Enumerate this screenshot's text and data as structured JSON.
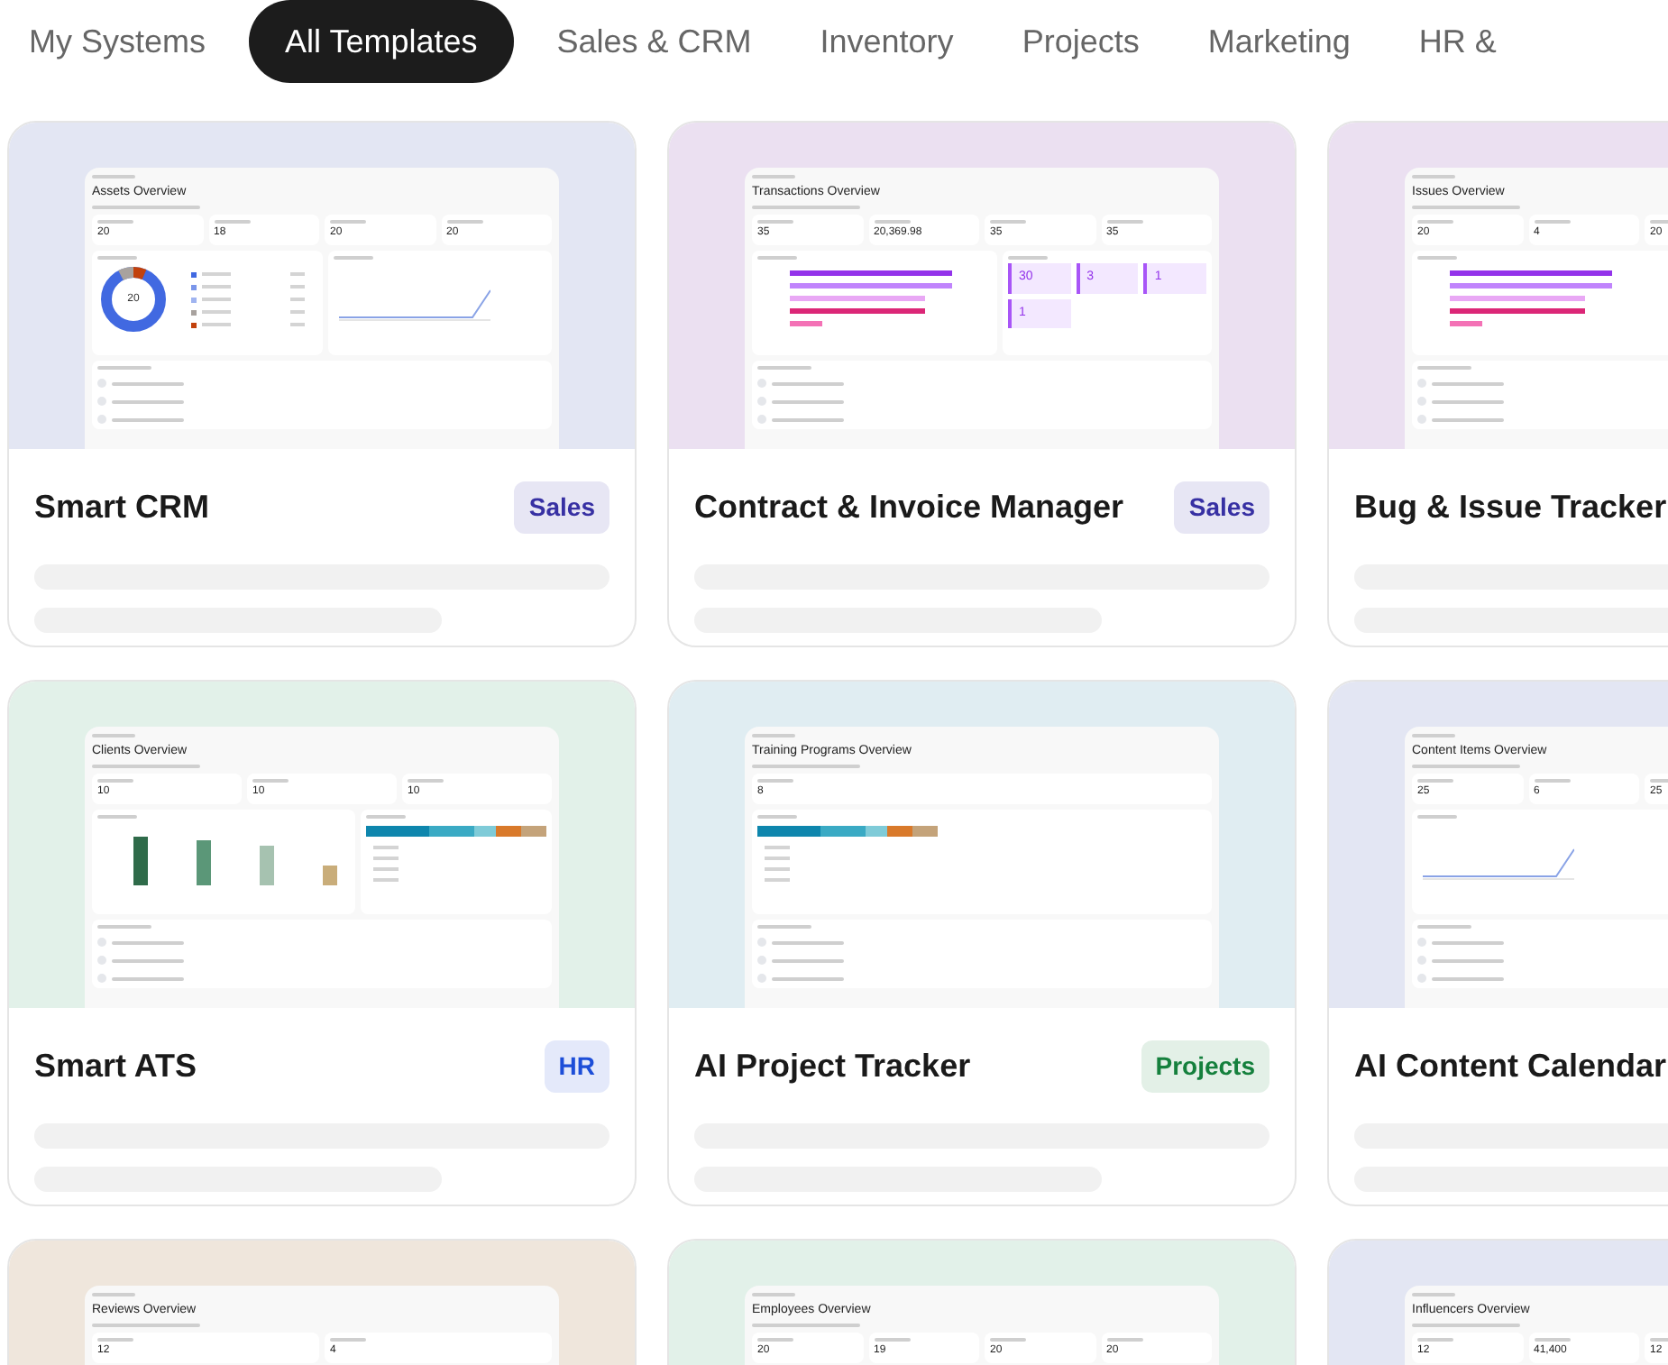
{
  "tabs": [
    {
      "label": "My Systems",
      "selected": false
    },
    {
      "label": "All Templates",
      "selected": true
    },
    {
      "label": "Sales & CRM",
      "selected": false
    },
    {
      "label": "Inventory",
      "selected": false
    },
    {
      "label": "Projects",
      "selected": false
    },
    {
      "label": "Marketing",
      "selected": false
    },
    {
      "label": "HR &",
      "selected": false
    }
  ],
  "templates": [
    {
      "title": "Smart CRM",
      "tag": {
        "label": "Sales",
        "color": "#3730a3"
      },
      "color": "#e3e6f3",
      "preview": {
        "title": "Assets Overview",
        "stats": [
          "20",
          "18",
          "20",
          "20"
        ],
        "charts": [
          {
            "kind": "donut",
            "center": "20"
          },
          {
            "kind": "line"
          }
        ]
      }
    },
    {
      "title": "Contract & Invoice Manager",
      "tag": {
        "label": "Sales",
        "color": "#3730a3"
      },
      "color": "#ebe0f1",
      "preview": {
        "title": "Transactions Overview",
        "stats": [
          "35",
          "20,369.98",
          "35",
          "35"
        ],
        "charts": [
          {
            "kind": "hbar"
          },
          {
            "kind": "tiles",
            "values": [
              "30",
              "3",
              "1",
              "1"
            ]
          }
        ]
      }
    },
    {
      "title": "Bug & Issue Tracker",
      "color": "#ebe0f1",
      "preview": {
        "title": "Issues Overview",
        "stats": [
          "20",
          "4",
          "20"
        ],
        "charts": [
          {
            "kind": "hbar"
          }
        ]
      }
    },
    {
      "title": "Smart ATS",
      "tag": {
        "label": "HR",
        "color": "#1d4ed8"
      },
      "color": "#e2f1e9",
      "preview": {
        "title": "Clients Overview",
        "stats": [
          "10",
          "10",
          "10"
        ],
        "charts": [
          {
            "kind": "vbar"
          },
          {
            "kind": "stacked"
          }
        ]
      }
    },
    {
      "title": "AI Project Tracker",
      "tag": {
        "label": "Projects",
        "color": "#15803d"
      },
      "color": "#e0edf2",
      "preview": {
        "title": "Training Programs Overview",
        "stats": [
          "8"
        ],
        "charts": [
          {
            "kind": "stacked"
          }
        ]
      }
    },
    {
      "title": "AI Content Calendar",
      "color": "#e3e6f3",
      "preview": {
        "title": "Content Items Overview",
        "stats": [
          "25",
          "6",
          "25"
        ],
        "charts": [
          {
            "kind": "line"
          }
        ]
      }
    },
    {
      "color": "#efe6dc",
      "preview": {
        "title": "Reviews Overview",
        "stats": [
          "12",
          "4"
        ]
      }
    },
    {
      "color": "#e2f1e9",
      "preview": {
        "title": "Employees Overview",
        "stats": [
          "20",
          "19",
          "20",
          "20"
        ]
      }
    },
    {
      "color": "#e3e6f3",
      "preview": {
        "title": "Influencers Overview",
        "stats": [
          "12",
          "41,400",
          "12"
        ]
      }
    }
  ]
}
